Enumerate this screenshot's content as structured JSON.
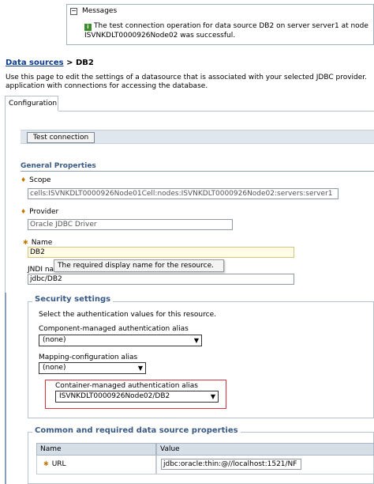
{
  "messages": {
    "title": "Messages",
    "line1": "The test connection operation for data source DB2 on server server1 at node",
    "line2": "ISVNKDLT0000926Node02 was successful."
  },
  "breadcrumb": {
    "link": "Data sources",
    "separator": ">",
    "current": "DB2"
  },
  "description": {
    "line1": "Use this page to edit the settings of a datasource that is associated with your selected JDBC provider.",
    "line2": "application with connections for accessing the database."
  },
  "tabs": [
    {
      "label": "Configuration"
    }
  ],
  "actions": {
    "test_connection": "Test connection"
  },
  "general": {
    "title": "General Properties",
    "scope_label": "Scope",
    "scope_value": "cells:ISVNKDLT0000926Node01Cell:nodes:ISVNKDLT0000926Node02:servers:server1",
    "provider_label": "Provider",
    "provider_value": "Oracle JDBC Driver",
    "name_label": "Name",
    "name_value": "DB2",
    "jndi_label": "JNDI na",
    "jndi_value": "jdbc/DB2",
    "tooltip": "The required display name for the resource."
  },
  "security": {
    "title": "Security settings",
    "instructions": "Select the authentication values for this resource.",
    "component_label": "Component-managed authentication alias",
    "component_value": "(none)",
    "mapping_label": "Mapping-configuration alias",
    "mapping_value": "(none)",
    "container_label": "Container-managed authentication alias",
    "container_value": "ISVNKDLT0000926Node02/DB2"
  },
  "common": {
    "title": "Common and required data source properties",
    "headers": [
      "Name",
      "Value"
    ],
    "rows": [
      {
        "name": "URL",
        "value": "jdbc:oracle:thin:@//localhost:1521/NF"
      }
    ]
  },
  "icons": {
    "collapse": "minus-box-icon",
    "info": "info-icon",
    "required": "required-marker-icon",
    "dropdown": "dropdown-arrow-icon"
  },
  "colors": {
    "link": "#0c3a8c",
    "section_title": "#3a5a86",
    "highlight_border": "#d9333f",
    "info_green": "#3a8d2a",
    "required_marker": "#c07a00"
  }
}
